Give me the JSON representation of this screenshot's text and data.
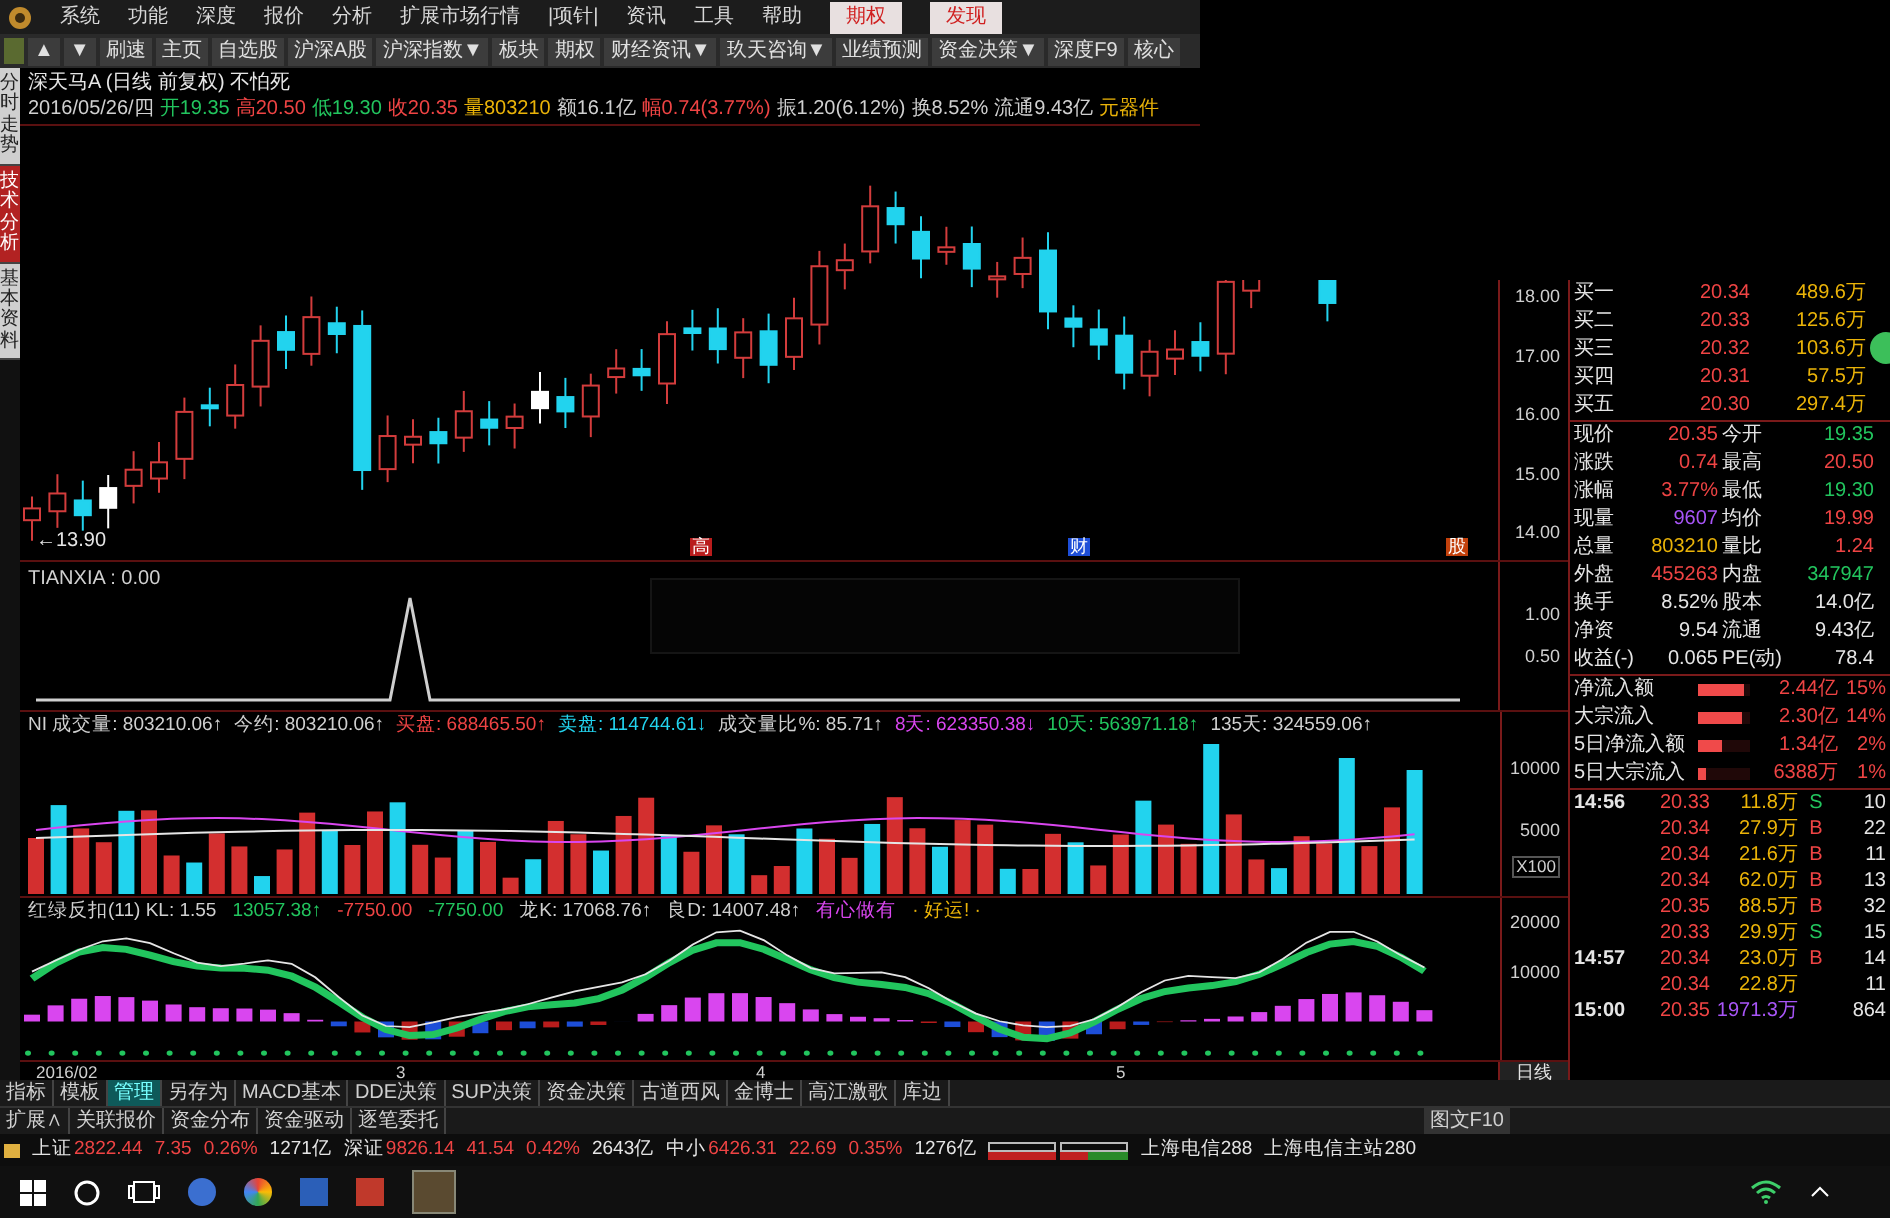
{
  "menu": {
    "items": [
      "系统",
      "功能",
      "深度",
      "报价",
      "分析",
      "扩展市场行情",
      "|项针|",
      "资讯",
      "工具",
      "帮助"
    ],
    "highlighted": [
      "期权",
      "发现"
    ]
  },
  "toolbar": {
    "items": [
      "▲",
      "▼",
      "刷速",
      "主页",
      "自选股",
      "沪深A股",
      "沪深指数▼",
      "板块",
      "期权",
      "财经资讯▼",
      "玖天咨询▼",
      "业绩预测",
      "资金决策▼",
      "深度F9",
      "核心"
    ]
  },
  "side_tabs": [
    {
      "label": "分时走势",
      "selected": false
    },
    {
      "label": "技术分析",
      "selected": true
    },
    {
      "label": "基本资料",
      "selected": false
    }
  ],
  "quote_header": {
    "title": "深天马A (日线 前复权) 不怕死",
    "fields": [
      {
        "text": "2016/05/26/四",
        "color": "#d0d0d0"
      },
      {
        "text": "开19.35",
        "color": "#22c55e"
      },
      {
        "text": "高20.50",
        "color": "#ef4444"
      },
      {
        "text": "低19.30",
        "color": "#22c55e"
      },
      {
        "text": "收20.35",
        "color": "#ef4444"
      },
      {
        "text": "量803210",
        "color": "#eab308"
      },
      {
        "text": "额16.1亿",
        "color": "#d0d0d0"
      },
      {
        "text": "幅0.74(3.77%)",
        "color": "#ef4444"
      },
      {
        "text": "振1.20(6.12%)",
        "color": "#d0d0d0"
      },
      {
        "text": "换8.52%",
        "color": "#d0d0d0"
      },
      {
        "text": "流通9.43亿",
        "color": "#d0d0d0"
      },
      {
        "text": "元器件",
        "color": "#eab308"
      }
    ]
  },
  "price_chart": {
    "axis": [
      "18.00",
      "17.00",
      "16.00",
      "15.00",
      "14.00"
    ],
    "low_label": "←13.90",
    "markers": [
      {
        "text": "高",
        "color": "#b91c1c"
      },
      {
        "text": "财",
        "color": "#1d4ed8"
      },
      {
        "text": "股",
        "color": "#c2410c"
      }
    ]
  },
  "tianxia": {
    "label": "TIANXIA : 0.00",
    "axis": [
      "1.00",
      "0.50"
    ]
  },
  "volume": {
    "legend": [
      {
        "text": "NI 成交量: 803210.06↑",
        "color": "#d0d0d0"
      },
      {
        "text": "今约: 803210.06↑",
        "color": "#d0d0d0"
      },
      {
        "text": "买盘: 688465.50↑",
        "color": "#ef4444"
      },
      {
        "text": "卖盘: 114744.61↓",
        "color": "#22d3ee"
      },
      {
        "text": "成交量比%: 85.71↑",
        "color": "#d0d0d0"
      },
      {
        "text": "8天: 623350.38↓",
        "color": "#d946ef"
      },
      {
        "text": "10天: 563971.18↑",
        "color": "#22c55e"
      },
      {
        "text": "135天: 324559.06↑",
        "color": "#d0d0d0"
      }
    ],
    "axis": [
      "10000",
      "5000"
    ],
    "unit": "X100"
  },
  "fankou": {
    "legend": [
      {
        "text": "红绿反扣(11) KL: 1.55",
        "color": "#d0d0d0"
      },
      {
        "text": "13057.38↑",
        "color": "#22c55e"
      },
      {
        "text": "-7750.00",
        "color": "#ef4444"
      },
      {
        "text": "-7750.00",
        "color": "#22c55e"
      },
      {
        "text": "龙K: 17068.76↑",
        "color": "#d0d0d0"
      },
      {
        "text": "良D: 14007.48↑",
        "color": "#d0d0d0"
      },
      {
        "text": "有心做有",
        "color": "#d946ef"
      },
      {
        "text": "· 好运! ·",
        "color": "#eab308"
      }
    ],
    "axis": [
      "20000",
      "10000"
    ]
  },
  "date_axis": {
    "labels": [
      "2016/02",
      "3",
      "4",
      "5"
    ],
    "period": "日线"
  },
  "order_book": [
    {
      "label": "买一",
      "price": "20.34",
      "volume": "489.6万"
    },
    {
      "label": "买二",
      "price": "20.33",
      "volume": "125.6万"
    },
    {
      "label": "买三",
      "price": "20.32",
      "volume": "103.6万"
    },
    {
      "label": "买四",
      "price": "20.31",
      "volume": "57.5万"
    },
    {
      "label": "买五",
      "price": "20.30",
      "volume": "297.4万"
    }
  ],
  "quote": [
    {
      "label": "现价",
      "value": "20.35",
      "color": "#ef4444"
    },
    {
      "label": "今开",
      "value": "19.35",
      "color": "#22c55e"
    },
    {
      "label": "涨跌",
      "value": "0.74",
      "color": "#ef4444"
    },
    {
      "label": "最高",
      "value": "20.50",
      "color": "#ef4444"
    },
    {
      "label": "涨幅",
      "value": "3.77%",
      "color": "#ef4444"
    },
    {
      "label": "最低",
      "value": "19.30",
      "color": "#22c55e"
    },
    {
      "label": "现量",
      "value": "9607",
      "color": "#a855f7"
    },
    {
      "label": "均价",
      "value": "19.99",
      "color": "#ef4444"
    },
    {
      "label": "总量",
      "value": "803210",
      "color": "#eab308"
    },
    {
      "label": "量比",
      "value": "1.24",
      "color": "#ef4444"
    },
    {
      "label": "外盘",
      "value": "455263",
      "color": "#ef4444"
    },
    {
      "label": "内盘",
      "value": "347947",
      "color": "#22c55e"
    },
    {
      "label": "换手",
      "value": "8.52%",
      "color": "#e5e5e5"
    },
    {
      "label": "股本",
      "value": "14.0亿",
      "color": "#e5e5e5"
    },
    {
      "label": "净资",
      "value": "9.54",
      "color": "#e5e5e5"
    },
    {
      "label": "流通",
      "value": "9.43亿",
      "color": "#e5e5e5"
    },
    {
      "label": "收益(-)",
      "value": "0.065",
      "color": "#e5e5e5"
    },
    {
      "label": "PE(动)",
      "value": "78.4",
      "color": "#e5e5e5"
    }
  ],
  "flows": [
    {
      "label": "净流入额",
      "level": 0.9,
      "amount": "2.44亿",
      "percent": "15%"
    },
    {
      "label": "大宗流入",
      "level": 0.85,
      "amount": "2.30亿",
      "percent": "14%"
    },
    {
      "label": "5日净流入额",
      "level": 0.45,
      "amount": "1.34亿",
      "percent": "2%"
    },
    {
      "label": "5日大宗流入",
      "level": 0.15,
      "amount": "6388万",
      "percent": "1%"
    }
  ],
  "ticks": [
    {
      "time": "14:56",
      "price": "20.33",
      "volume": "11.8万",
      "side": "S",
      "kind": "sell",
      "count": "10",
      "color": "#eab308"
    },
    {
      "price": "20.34",
      "volume": "27.9万",
      "side": "B",
      "kind": "buy",
      "count": "22",
      "color": "#eab308"
    },
    {
      "price": "20.34",
      "volume": "21.6万",
      "side": "B",
      "kind": "buy",
      "count": "11",
      "color": "#eab308"
    },
    {
      "price": "20.34",
      "volume": "62.0万",
      "side": "B",
      "kind": "buy",
      "count": "13",
      "color": "#eab308"
    },
    {
      "price": "20.35",
      "volume": "88.5万",
      "side": "B",
      "kind": "buy",
      "count": "32",
      "color": "#eab308"
    },
    {
      "price": "20.33",
      "volume": "29.9万",
      "side": "S",
      "kind": "sell",
      "count": "15",
      "color": "#eab308"
    },
    {
      "time": "14:57",
      "price": "20.34",
      "volume": "23.0万",
      "side": "B",
      "kind": "buy",
      "count": "14",
      "color": "#eab308"
    },
    {
      "price": "20.34",
      "volume": "22.8万",
      "count": "11",
      "color": "#eab308"
    },
    {
      "time": "15:00",
      "price": "20.35",
      "volume": "1971.3万",
      "count": "864",
      "color": "#a855f7"
    }
  ],
  "bottom_tabs": [
    {
      "label": "指标",
      "selected": false
    },
    {
      "label": "模板",
      "selected": false
    },
    {
      "label": "管理",
      "selected": true
    },
    {
      "label": "另存为",
      "selected": false
    },
    {
      "label": "MACD基本",
      "selected": false
    },
    {
      "label": "DDE决策",
      "selected": false
    },
    {
      "label": "SUP决策",
      "selected": false
    },
    {
      "label": "资金决策",
      "selected": false
    },
    {
      "label": "古道西风",
      "selected": false
    },
    {
      "label": "金博士",
      "selected": false
    },
    {
      "label": "高江激歌",
      "selected": false
    },
    {
      "label": "库边",
      "selected": false
    }
  ],
  "sub_tabs": [
    "扩展∧",
    "关联报价",
    "资金分布",
    "资金驱动",
    "逐笔委托"
  ],
  "f10": "图文F10",
  "status_bar": {
    "indices": [
      {
        "name": "上证",
        "value": "2822.44",
        "change": "7.35",
        "percent": "0.26%",
        "amount": "1271亿"
      },
      {
        "name": "深证",
        "value": "9826.14",
        "change": "41.54",
        "percent": "0.42%",
        "amount": "2643亿"
      },
      {
        "name": "中小",
        "value": "6426.31",
        "change": "22.69",
        "percent": "0.35%",
        "amount": "1276亿"
      }
    ],
    "servers": [
      "上海电信288",
      "上海电信主站280"
    ]
  }
}
